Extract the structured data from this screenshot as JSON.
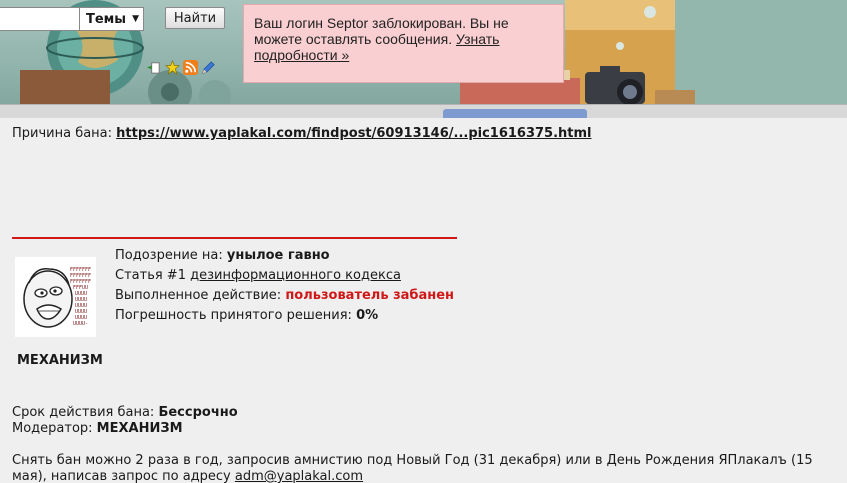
{
  "header": {
    "search_value": "",
    "search_scope": "Темы",
    "search_button": "Найти",
    "icons": [
      "new-post-icon",
      "favorites-star-icon",
      "rss-icon",
      "edit-pencil-icon"
    ],
    "colors": {
      "alert_bg": "#f9cfd2",
      "accent_red": "#d01818"
    }
  },
  "alert": {
    "text": "Ваш логин Septor заблокирован. Вы не можете оставлять сообщения. ",
    "link": "Узнать подробности »"
  },
  "ban": {
    "reason_label": "Причина бана: ",
    "reason_link": "https://www.yaplakal.com/findpost/60913146/...pic1616375.html",
    "suspicion_label": "Подозрение на: ",
    "suspicion_value": "унылое гавно",
    "article_label": "Статья #1 ",
    "article_link": "дезинформационного кодекса",
    "action_label": "Выполненное действие: ",
    "action_value": "пользователь забанен",
    "error_label": "Погрешность принятого решения: ",
    "error_value": "0%",
    "avatar_name": "МЕХАНИЗМ",
    "term_label": "Срок действия бана: ",
    "term_value": "Бессрочно",
    "moderator_label": "Модератор: ",
    "moderator_value": "МЕХАНИЗМ",
    "amnesty_text": "Снять бан можно 2 раза в год, запросив амнистию под Новый Год (31 декабря) или в День Рождения ЯПлакалъ (15 мая), написав запрос по адресу ",
    "amnesty_email": "adm@yaplakal.com"
  }
}
